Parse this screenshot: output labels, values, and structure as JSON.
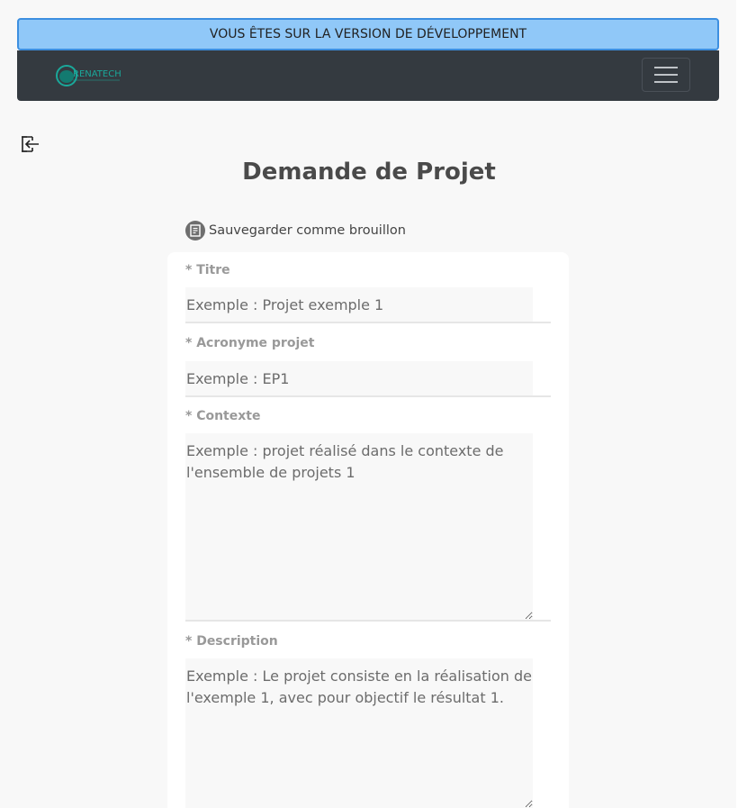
{
  "banner": {
    "text": "VOUS ÊTES SUR LA VERSION DE DÉVELOPPEMENT"
  },
  "navbar": {
    "logo_text": "RENATECH",
    "logo_subtext": "",
    "toggle_icon": "hamburger-menu-icon"
  },
  "logout": {
    "icon": "logout-icon"
  },
  "page": {
    "title": "Demande de Projet"
  },
  "draft": {
    "label": "Sauvegarder comme brouillon",
    "icon": "save-draft-icon"
  },
  "form": {
    "titre": {
      "label": "* Titre",
      "placeholder": "Exemple : Projet exemple 1"
    },
    "acronyme": {
      "label": "* Acronyme projet",
      "placeholder": "Exemple : EP1"
    },
    "contexte": {
      "label": "* Contexte",
      "placeholder": "Exemple : projet réalisé dans le contexte de l'ensemble de projets 1"
    },
    "description": {
      "label": "* Description",
      "placeholder": "Exemple : Le projet consiste en la réalisation de l'exemple 1, avec pour objectif le résultat 1."
    }
  },
  "colors": {
    "banner_bg": "#90c8f8",
    "banner_border": "#3d8fe0",
    "navbar_bg": "#343a40",
    "logo_teal": "#1aa89a",
    "page_bg": "#f8f8f8"
  }
}
